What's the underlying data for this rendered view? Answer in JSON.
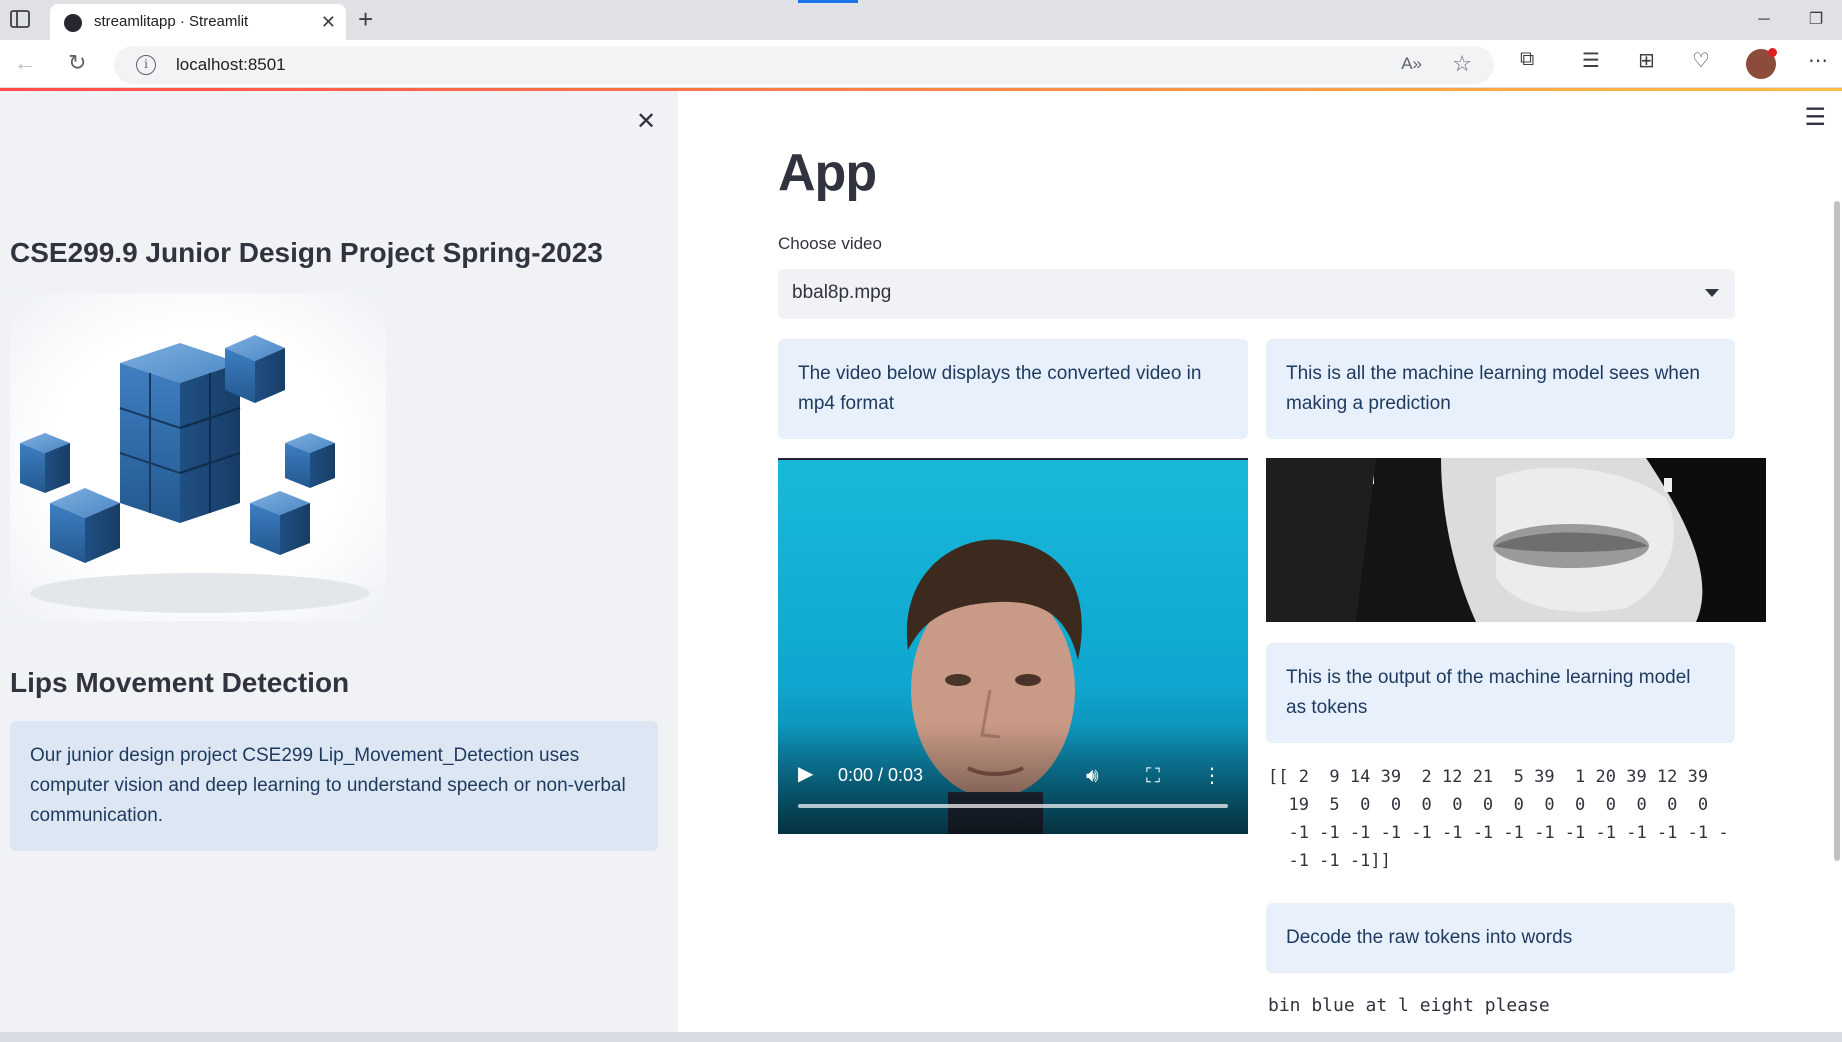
{
  "browser": {
    "tab_title": "streamlitapp · Streamlit",
    "url": "localhost:8501"
  },
  "sidebar": {
    "project_title": "CSE299.9 Junior Design Project Spring-2023",
    "image_icon": "blue-cubes-image",
    "section_title": "Lips Movement Detection",
    "description": "Our junior design project CSE299 Lip_Movement_Detection uses computer vision and deep learning to understand speech or non-verbal communication."
  },
  "main": {
    "title": "App",
    "select_label": "Choose video",
    "select_value": "bbal8p.mpg",
    "info_video": "The video below displays the converted video in mp4 format",
    "info_model_sees": "This is all the machine learning model sees when making a prediction",
    "info_tokens": "This is the output of the machine learning model as tokens",
    "tokens_text": "[[ 2  9 14 39  2 12 21  5 39  1 20 39 12 39\n  19  5  0  0  0  0  0  0  0  0  0  0  0  0\n  -1 -1 -1 -1 -1 -1 -1 -1 -1 -1 -1 -1 -1 -1 -\n  -1 -1 -1]]",
    "info_decode": "Decode the raw tokens into words",
    "decoded_text": "bin blue at l eight please",
    "video_time": "0:00 / 0:03"
  },
  "colors": {
    "sidebar_bg": "#f0f2f6",
    "info_bg": "#e7f0fb",
    "info_text": "#1e3a5f",
    "accent_gradient_start": "#ff4b4b",
    "accent_gradient_end": "#ffbd45"
  }
}
